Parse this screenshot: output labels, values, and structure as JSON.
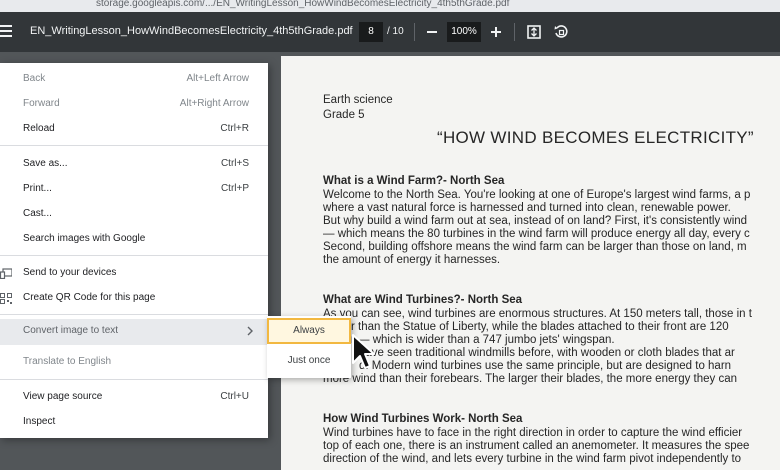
{
  "browser": {
    "url_fragment": "storage.googleapis.com/.../EN_WritingLesson_HowWindBecomesElectricity_4th5thGrade.pdf"
  },
  "toolbar": {
    "menu_icon": "hamburger-menu-icon",
    "file_name": "EN_WritingLesson_HowWindBecomesElectricity_4th5thGrade.pdf",
    "current_page": "8",
    "total_pages": "/ 10",
    "zoom_out_icon": "minus-icon",
    "zoom_level": "100%",
    "zoom_in_icon": "plus-icon",
    "fit_icon": "fit-to-page-icon",
    "rotate_icon": "rotate-icon"
  },
  "context_menu": {
    "back": {
      "label": "Back",
      "shortcut": "Alt+Left Arrow"
    },
    "forward": {
      "label": "Forward",
      "shortcut": "Alt+Right Arrow"
    },
    "reload": {
      "label": "Reload",
      "shortcut": "Ctrl+R"
    },
    "save_as": {
      "label": "Save as...",
      "shortcut": "Ctrl+S"
    },
    "print": {
      "label": "Print...",
      "shortcut": "Ctrl+P"
    },
    "cast": {
      "label": "Cast..."
    },
    "search_images": {
      "label": "Search images with Google"
    },
    "send_devices": {
      "label": "Send to your devices",
      "icon": "devices-icon"
    },
    "qr_code": {
      "label": "Create QR Code for this page",
      "icon": "qr-code-icon"
    },
    "convert_image": {
      "label": "Convert image to text"
    },
    "translate": {
      "label": "Translate to English"
    },
    "view_source": {
      "label": "View page source",
      "shortcut": "Ctrl+U"
    },
    "inspect": {
      "label": "Inspect"
    }
  },
  "submenu": {
    "always": "Always",
    "just_once": "Just once"
  },
  "document": {
    "subject": "Earth science",
    "grade": "Grade 5",
    "title": "“HOW WIND BECOMES ELECTRICITY”",
    "s1_heading": "What is a Wind Farm?- North Sea",
    "s1_lines": [
      "Welcome to the North Sea. You're looking at one of Europe's largest wind farms, a p",
      "where a vast natural force is harnessed and turned into clean, renewable power.",
      "But why build a wind farm out at sea, instead of on land? First, it's consistently wind",
      "— which means the 80 turbines in the wind farm will produce energy all day, every c",
      "Second, building offshore means the wind farm can be larger than those on land, m",
      "the amount of energy it harnesses."
    ],
    "s2_heading": "What are Wind Turbines?- North Sea",
    "s2_lines": [
      "As you can see, wind turbines are enormous structures. At 150 meters tall, those in t",
      "r than the Statue of Liberty, while the blades attached to their front are 120",
      "r — which is wider than a 747 jumbo jets' wingspan.",
      "have seen traditional windmills before, with wooden or cloth blades that ar",
      "d. Modern wind turbines use the same principle, but are designed to harn",
      "more wind than their forebears. The larger their blades, the more energy they can"
    ],
    "s3_heading": "How Wind Turbines Work- North Sea",
    "s3_lines": [
      "Wind turbines have to face in the right direction in order to capture the wind efficier",
      "top of each one, there is an instrument called an anemometer. It measures the spee",
      "direction of the wind, and lets every turbine in the wind farm pivot independently to"
    ]
  },
  "cursor_icon": "mouse-pointer-icon"
}
